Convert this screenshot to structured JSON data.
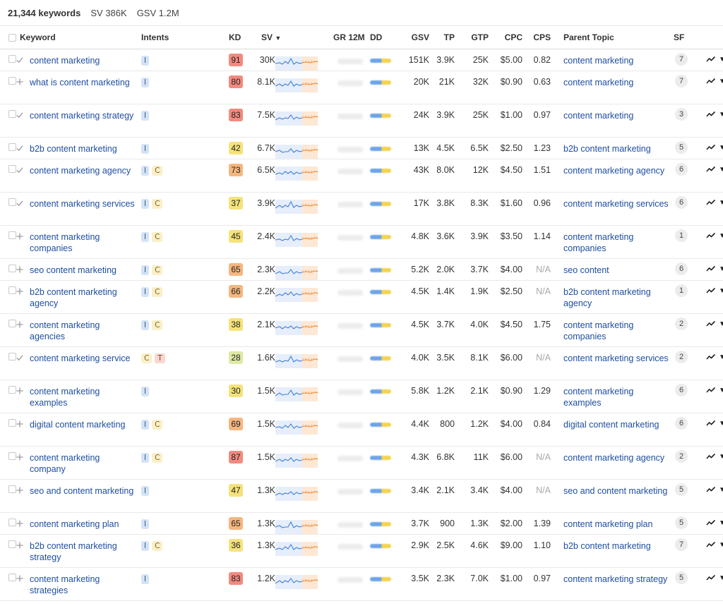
{
  "summary": {
    "keywords": "21,344 keywords",
    "sv": "SV 386K",
    "gsv": "GSV 1.2M"
  },
  "columns": {
    "keyword": "Keyword",
    "intents": "Intents",
    "kd": "KD",
    "sv": "SV",
    "gr": "GR 12M",
    "dd": "DD",
    "gsv": "GSV",
    "tp": "TP",
    "gtp": "GTP",
    "cpc": "CPC",
    "cps": "CPS",
    "parent": "Parent Topic",
    "sf": "SF"
  },
  "kd_colors": {
    "green": "#dfe8a4",
    "yellow": "#f5e27a",
    "orange": "#f5b77f",
    "red": "#f28a7f"
  },
  "rows": [
    {
      "keyword": "content marketing",
      "added": true,
      "intents": [
        "I"
      ],
      "kd": "91",
      "kd_color": "#f28a7f",
      "sv": "30K",
      "gsv": "151K",
      "tp": "3.9K",
      "gtp": "25K",
      "cpc": "$5.00",
      "cps": "0.82",
      "parent": "content marketing",
      "sf": "7"
    },
    {
      "keyword": "what is content marketing",
      "added": false,
      "intents": [
        "I"
      ],
      "kd": "80",
      "kd_color": "#f28a7f",
      "sv": "8.1K",
      "gsv": "20K",
      "tp": "21K",
      "gtp": "32K",
      "cpc": "$0.90",
      "cps": "0.63",
      "parent": "content marketing",
      "sf": "7"
    },
    {
      "keyword": "content marketing strategy",
      "added": true,
      "intents": [
        "I"
      ],
      "kd": "83",
      "kd_color": "#f28a7f",
      "sv": "7.5K",
      "gsv": "24K",
      "tp": "3.9K",
      "gtp": "25K",
      "cpc": "$1.00",
      "cps": "0.97",
      "parent": "content marketing",
      "sf": "3"
    },
    {
      "keyword": "b2b content marketing",
      "added": true,
      "intents": [
        "I"
      ],
      "kd": "42",
      "kd_color": "#f5e27a",
      "sv": "6.7K",
      "gsv": "13K",
      "tp": "4.5K",
      "gtp": "6.5K",
      "cpc": "$2.50",
      "cps": "1.23",
      "parent": "b2b content marketing",
      "sf": "5"
    },
    {
      "keyword": "content marketing agency",
      "added": true,
      "intents": [
        "I",
        "C"
      ],
      "kd": "73",
      "kd_color": "#f5b77f",
      "sv": "6.5K",
      "gsv": "43K",
      "tp": "8.0K",
      "gtp": "12K",
      "cpc": "$4.50",
      "cps": "1.51",
      "parent": "content marketing agency",
      "sf": "6"
    },
    {
      "keyword": "content marketing services",
      "added": true,
      "intents": [
        "I",
        "C"
      ],
      "kd": "37",
      "kd_color": "#f5e27a",
      "sv": "3.9K",
      "gsv": "17K",
      "tp": "3.8K",
      "gtp": "8.3K",
      "cpc": "$1.60",
      "cps": "0.96",
      "parent": "content marketing services",
      "sf": "6"
    },
    {
      "keyword": "content marketing companies",
      "added": false,
      "intents": [
        "I",
        "C"
      ],
      "kd": "45",
      "kd_color": "#f5e27a",
      "sv": "2.4K",
      "gsv": "4.8K",
      "tp": "3.6K",
      "gtp": "3.9K",
      "cpc": "$3.50",
      "cps": "1.14",
      "parent": "content marketing companies",
      "sf": "1"
    },
    {
      "keyword": "seo content marketing",
      "added": false,
      "intents": [
        "I",
        "C"
      ],
      "kd": "65",
      "kd_color": "#f5b77f",
      "sv": "2.3K",
      "gsv": "5.2K",
      "tp": "2.0K",
      "gtp": "3.7K",
      "cpc": "$4.00",
      "cps": "N/A",
      "parent": "seo content",
      "sf": "6"
    },
    {
      "keyword": "b2b content marketing agency",
      "added": false,
      "intents": [
        "I",
        "C"
      ],
      "kd": "66",
      "kd_color": "#f5b77f",
      "sv": "2.2K",
      "gsv": "4.5K",
      "tp": "1.4K",
      "gtp": "1.9K",
      "cpc": "$2.50",
      "cps": "N/A",
      "parent": "b2b content marketing agency",
      "sf": "1"
    },
    {
      "keyword": "content marketing agencies",
      "added": false,
      "intents": [
        "I",
        "C"
      ],
      "kd": "38",
      "kd_color": "#f5e27a",
      "sv": "2.1K",
      "gsv": "4.5K",
      "tp": "3.7K",
      "gtp": "4.0K",
      "cpc": "$4.50",
      "cps": "1.75",
      "parent": "content marketing companies",
      "sf": "2"
    },
    {
      "keyword": "content marketing service",
      "added": true,
      "intents": [
        "C",
        "T"
      ],
      "kd": "28",
      "kd_color": "#dfe8a4",
      "sv": "1.6K",
      "gsv": "4.0K",
      "tp": "3.5K",
      "gtp": "8.1K",
      "cpc": "$6.00",
      "cps": "N/A",
      "parent": "content marketing services",
      "sf": "2"
    },
    {
      "keyword": "content marketing examples",
      "added": false,
      "intents": [
        "I"
      ],
      "kd": "30",
      "kd_color": "#f5e27a",
      "sv": "1.5K",
      "gsv": "5.8K",
      "tp": "1.2K",
      "gtp": "2.1K",
      "cpc": "$0.90",
      "cps": "1.29",
      "parent": "content marketing examples",
      "sf": "6"
    },
    {
      "keyword": "digital content marketing",
      "added": false,
      "intents": [
        "I",
        "C"
      ],
      "kd": "69",
      "kd_color": "#f5b77f",
      "sv": "1.5K",
      "gsv": "4.4K",
      "tp": "800",
      "gtp": "1.2K",
      "cpc": "$4.00",
      "cps": "0.84",
      "parent": "digital content marketing",
      "sf": "6"
    },
    {
      "keyword": "content marketing company",
      "added": false,
      "intents": [
        "I",
        "C"
      ],
      "kd": "87",
      "kd_color": "#f28a7f",
      "sv": "1.5K",
      "gsv": "4.3K",
      "tp": "6.8K",
      "gtp": "11K",
      "cpc": "$6.00",
      "cps": "N/A",
      "parent": "content marketing agency",
      "sf": "2"
    },
    {
      "keyword": "seo and content marketing",
      "added": false,
      "intents": [
        "I"
      ],
      "kd": "47",
      "kd_color": "#f5e27a",
      "sv": "1.3K",
      "gsv": "3.4K",
      "tp": "2.1K",
      "gtp": "3.4K",
      "cpc": "$4.00",
      "cps": "N/A",
      "parent": "seo and content marketing",
      "sf": "5"
    },
    {
      "keyword": "content marketing plan",
      "added": false,
      "intents": [
        "I"
      ],
      "kd": "65",
      "kd_color": "#f5b77f",
      "sv": "1.3K",
      "gsv": "3.7K",
      "tp": "900",
      "gtp": "1.3K",
      "cpc": "$2.00",
      "cps": "1.39",
      "parent": "content marketing plan",
      "sf": "5"
    },
    {
      "keyword": "b2b content marketing strategy",
      "added": false,
      "intents": [
        "I",
        "C"
      ],
      "kd": "36",
      "kd_color": "#f5e27a",
      "sv": "1.3K",
      "gsv": "2.9K",
      "tp": "2.5K",
      "gtp": "4.6K",
      "cpc": "$9.00",
      "cps": "1.10",
      "parent": "b2b content marketing",
      "sf": "7"
    },
    {
      "keyword": "content marketing strategies",
      "added": false,
      "intents": [
        "I"
      ],
      "kd": "83",
      "kd_color": "#f28a7f",
      "sv": "1.2K",
      "gsv": "3.5K",
      "tp": "2.3K",
      "gtp": "7.0K",
      "cpc": "$1.00",
      "cps": "0.97",
      "parent": "content marketing strategy",
      "sf": "5"
    }
  ]
}
